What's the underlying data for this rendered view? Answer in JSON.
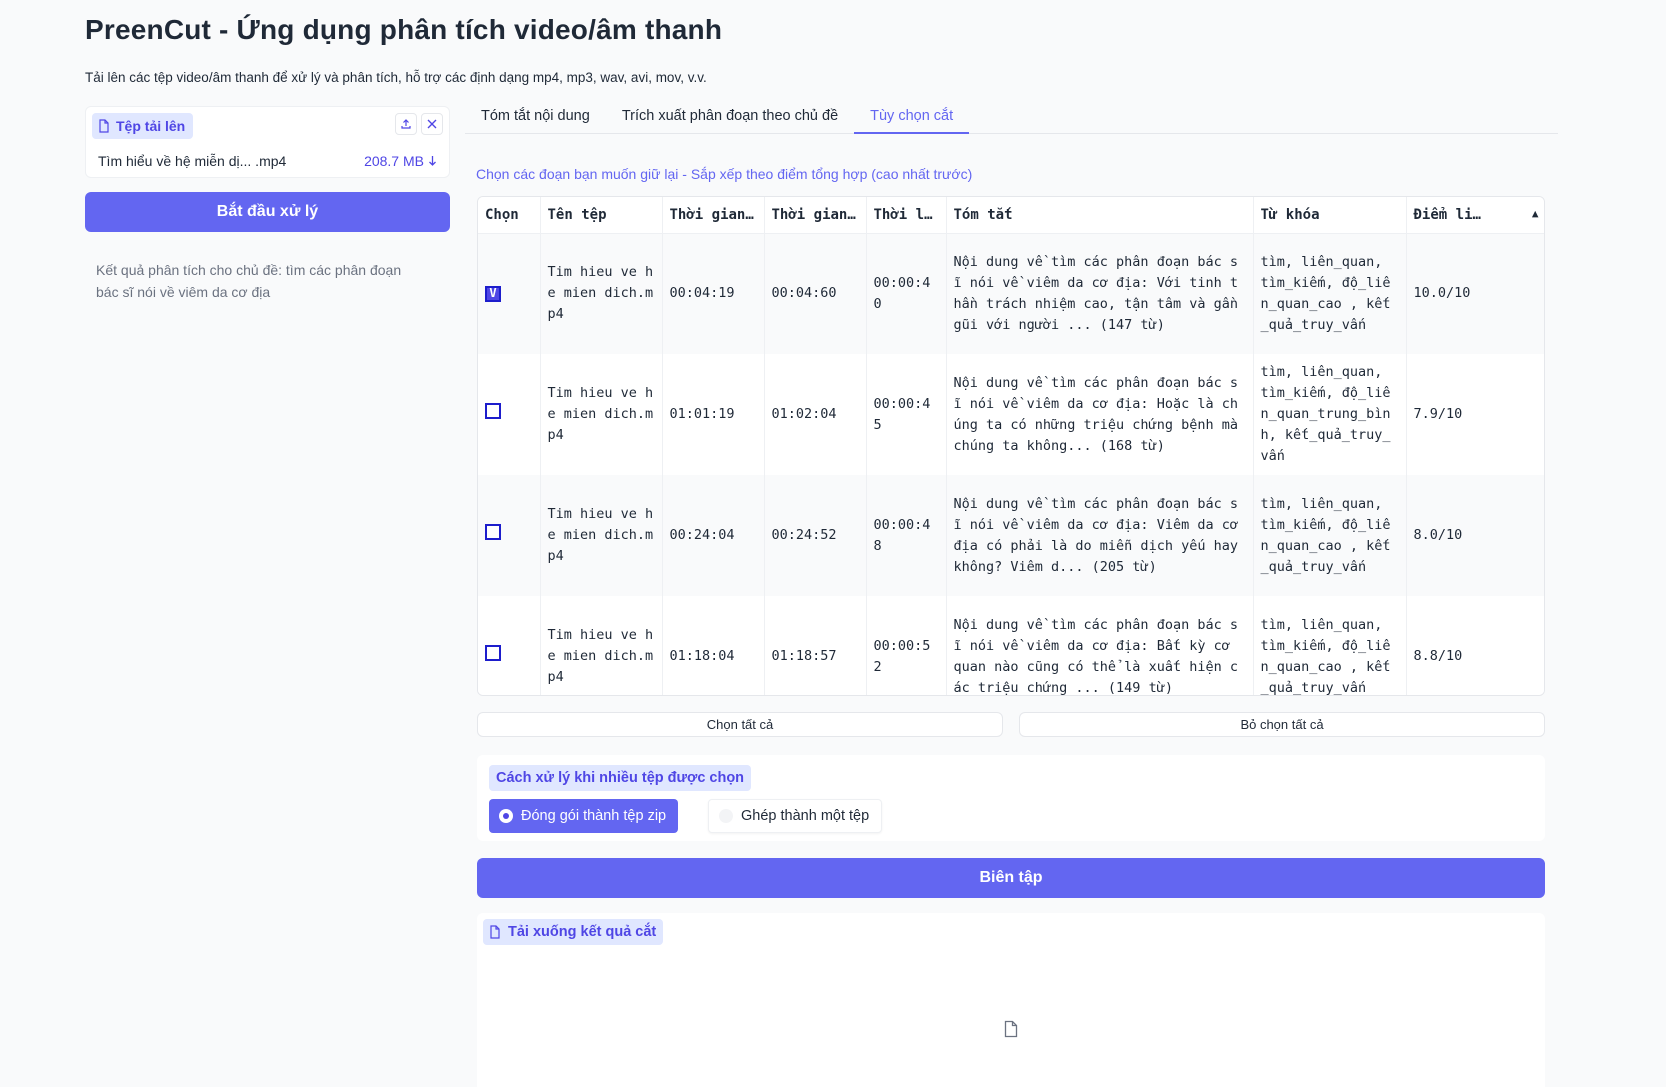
{
  "header": {
    "title": "PreenCut - Ứng dụng phân tích video/âm thanh",
    "description": "Tải lên các tệp video/âm thanh để xử lý và phân tích, hỗ trợ các định dạng mp4, mp3, wav, avi, mov, v.v."
  },
  "upload": {
    "label": "Tệp tải lên",
    "file_name": "Tìm hiểu về hệ miễn dị... .mp4",
    "file_size": "208.7 MB"
  },
  "start_button": "Bắt đầu xử lý",
  "result_text": "Kết quả phân tích cho chủ đề: tìm các phân đoạn bác sĩ nói về viêm da cơ địa",
  "tabs": [
    {
      "label": "Tóm tắt nội dung",
      "active": false
    },
    {
      "label": "Trích xuất phân đoạn theo chủ đề",
      "active": false
    },
    {
      "label": "Tùy chọn cắt",
      "active": true
    }
  ],
  "hint": "Chọn các đoạn bạn muốn giữ lại - Sắp xếp theo điểm tổng hợp (cao nhất trước)",
  "table": {
    "headers": [
      "Chọn",
      "Tên tệp",
      "Thời gian…",
      "Thời gian…",
      "Thời lư…",
      "Tóm tắt",
      "Từ khóa",
      "Điểm li…"
    ],
    "rows": [
      {
        "checked": true,
        "mark": "V",
        "file": "Tim hieu ve he mien dich.mp4",
        "start": "00:04:19",
        "end": "00:04:60",
        "duration": "00:00:40",
        "summary": "Nội dung về tìm các phân đoạn bác sĩ nói về viêm da cơ địa: Với tinh thần trách nhiệm cao, tận tâm và gần gũi với người ... (147 từ)",
        "keywords": "tìm, liên_quan, tìm_kiếm, độ_liên_quan_cao , kết_quả_truy_vấn",
        "score": "10.0/10"
      },
      {
        "checked": false,
        "mark": "",
        "file": "Tim hieu ve he mien dich.mp4",
        "start": "01:01:19",
        "end": "01:02:04",
        "duration": "00:00:45",
        "summary": "Nội dung về tìm các phân đoạn bác sĩ nói về viêm da cơ địa: Hoặc là chúng ta có những triệu chứng bệnh mà chúng ta không... (168 từ)",
        "keywords": "tìm, liên_quan, tìm_kiếm, độ_liên_quan_trung_bình, kết_quả_truy_vấn",
        "score": "7.9/10"
      },
      {
        "checked": false,
        "mark": "",
        "file": "Tim hieu ve he mien dich.mp4",
        "start": "00:24:04",
        "end": "00:24:52",
        "duration": "00:00:48",
        "summary": "Nội dung về tìm các phân đoạn bác sĩ nói về viêm da cơ địa: Viêm da cơ địa có phải là do miễn dịch yếu hay không? Viêm d... (205 từ)",
        "keywords": "tìm, liên_quan, tìm_kiếm, độ_liên_quan_cao , kết_quả_truy_vấn",
        "score": "8.0/10"
      },
      {
        "checked": false,
        "mark": "",
        "file": "Tim hieu ve he mien dich.mp4",
        "start": "01:18:04",
        "end": "01:18:57",
        "duration": "00:00:52",
        "summary": "Nội dung về tìm các phân đoạn bác sĩ nói về viêm da cơ địa: Bất kỳ cơ quan nào cũng có thể là xuất hiện các triệu chứng ... (149 từ)",
        "keywords": "tìm, liên_quan, tìm_kiếm, độ_liên_quan_cao , kết_quả_truy_vấn",
        "score": "8.8/10"
      }
    ]
  },
  "select_all": "Chọn tất cả",
  "deselect_all": "Bỏ chọn tất cả",
  "multi_file": {
    "label": "Cách xử lý khi nhiều tệp được chọn",
    "options": [
      "Đóng gói thành tệp zip",
      "Ghép thành một tệp"
    ],
    "selected": "Đóng gói thành tệp zip"
  },
  "edit_button": "Biên tập",
  "download": {
    "label": "Tải xuống kết quả cắt"
  },
  "colors": {
    "accent": "#6366f1",
    "accent_dark": "#4f46e5",
    "label_bg": "#e0e7ff",
    "background": "#f9fafb"
  },
  "icons": {
    "file": "file-icon",
    "upload": "upload-icon",
    "close": "close-icon",
    "download": "download-arrow-icon",
    "sort": "sort-asc-icon"
  }
}
